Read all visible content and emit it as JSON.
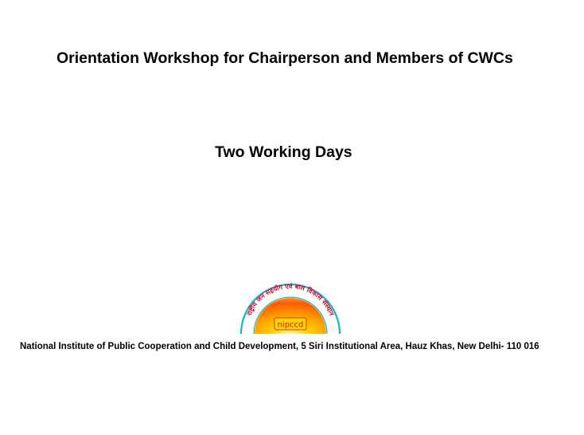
{
  "document": {
    "title": "Orientation Workshop for Chairperson and Members of CWCs",
    "subtitle": "Two Working Days",
    "footer": "National Institute of Public Cooperation and Child Development, 5 Siri Institutional Area, Hauz Khas, New Delhi- 110 016"
  },
  "logo": {
    "icon": "nipccd-logo",
    "arc_text": "राष्ट्रीय जन सहयोग एवं बाल विकास संस्थान",
    "mark_text": "nipccd",
    "colors": {
      "sun_core": "#ffd400",
      "sun_mid": "#ff9a00",
      "sun_outer": "#ff5a00",
      "ring": "#19b3c4",
      "arc_text": "#c8102e"
    }
  }
}
